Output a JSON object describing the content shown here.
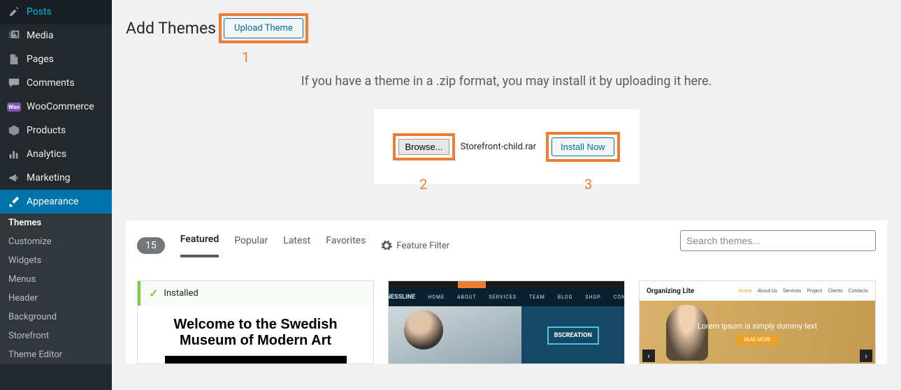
{
  "sidebar": {
    "items": [
      {
        "label": "Posts"
      },
      {
        "label": "Media"
      },
      {
        "label": "Pages"
      },
      {
        "label": "Comments"
      },
      {
        "label": "WooCommerce"
      },
      {
        "label": "Products"
      },
      {
        "label": "Analytics"
      },
      {
        "label": "Marketing"
      },
      {
        "label": "Appearance"
      }
    ],
    "sub": [
      "Themes",
      "Customize",
      "Widgets",
      "Menus",
      "Header",
      "Background",
      "Storefront",
      "Theme Editor"
    ]
  },
  "page": {
    "title": "Add Themes",
    "upload_button": "Upload Theme",
    "instruction": "If you have a theme in a .zip format, you may install it by uploading it here.",
    "browse_button": "Browse...",
    "selected_file": "Storefront-child.rar",
    "install_button": "Install Now"
  },
  "annotations": {
    "one": "1",
    "two": "2",
    "three": "3"
  },
  "browser": {
    "count": "15",
    "tabs": {
      "featured": "Featured",
      "popular": "Popular",
      "latest": "Latest",
      "favorites": "Favorites",
      "feature_filter": "Feature Filter"
    },
    "search_placeholder": "Search themes...",
    "themes": {
      "t1": {
        "installed": "Installed",
        "headline1": "Welcome to the Swedish",
        "headline2": "Museum of Modern Art"
      },
      "t2": {
        "logo": "BUSINESSLINE",
        "nav": [
          "HOME",
          "ABOUT",
          "SERVICES",
          "TEAM",
          "BLOG",
          "SHOP",
          "CONTACT"
        ],
        "badge": "BSCREATION"
      },
      "t3": {
        "title": "Organizing Lite",
        "nav": [
          "Home",
          "About Us",
          "Services",
          "Project",
          "Clients",
          "Contacts"
        ],
        "caption": "Lorem Ipsum is simply dummy text",
        "button": "READ MORE"
      }
    }
  }
}
